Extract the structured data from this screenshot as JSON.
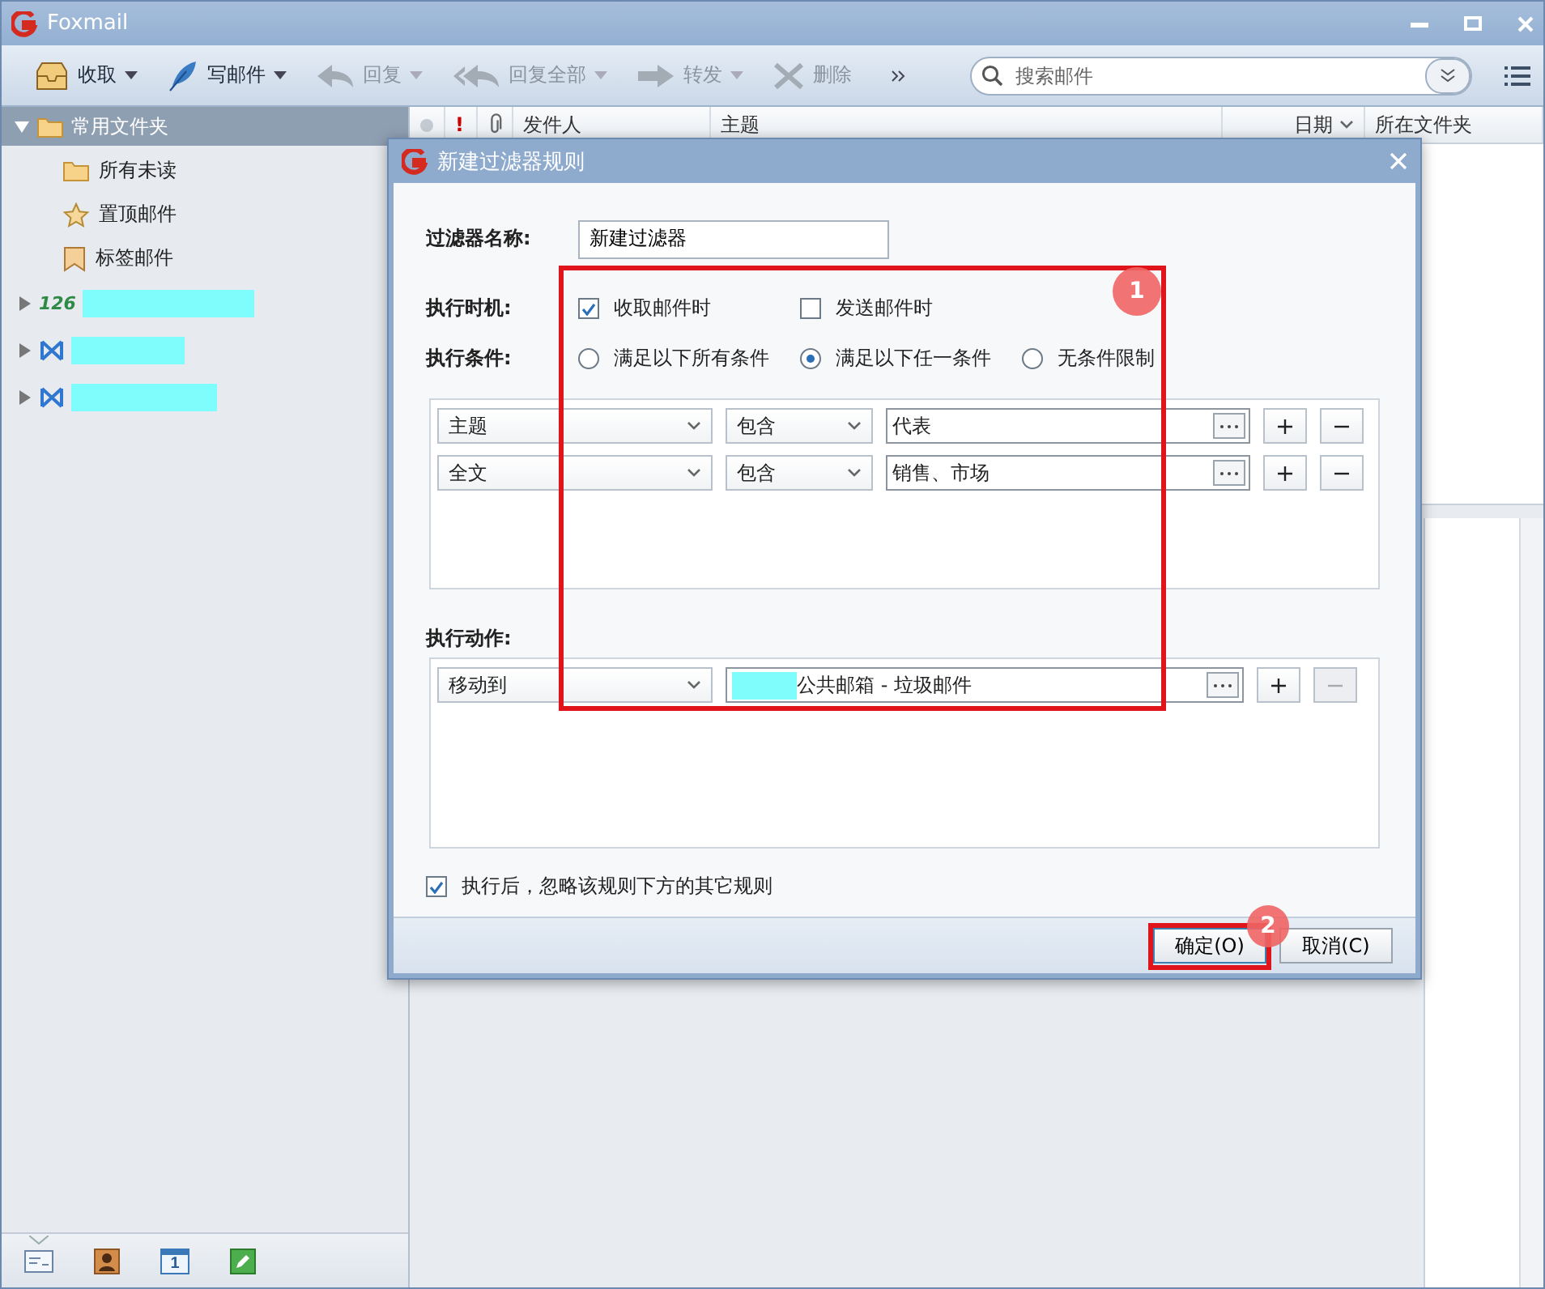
{
  "window": {
    "title": "Foxmail"
  },
  "toolbar": [
    {
      "kind": "receive",
      "label": "收取",
      "dropdown": true,
      "disabled": false
    },
    {
      "kind": "compose",
      "label": "写邮件",
      "dropdown": true,
      "disabled": false
    },
    {
      "kind": "reply",
      "label": "回复",
      "dropdown": true,
      "disabled": true
    },
    {
      "kind": "reply-all",
      "label": "回复全部",
      "dropdown": true,
      "disabled": true
    },
    {
      "kind": "forward",
      "label": "转发",
      "dropdown": true,
      "disabled": true
    },
    {
      "kind": "delete",
      "label": "删除",
      "dropdown": false,
      "disabled": true
    }
  ],
  "search": {
    "placeholder": "搜索邮件"
  },
  "sidebar": {
    "groups": [
      {
        "label": "常用文件夹",
        "expanded": true,
        "children": [
          {
            "kind": "folder",
            "label": "所有未读"
          },
          {
            "kind": "star",
            "label": "置顶邮件"
          },
          {
            "kind": "tag",
            "label": "标签邮件"
          }
        ]
      }
    ],
    "accounts": [
      {
        "kind": "netease",
        "logo_text": "126",
        "expanded": false
      },
      {
        "kind": "exchange",
        "expanded": false
      },
      {
        "kind": "exchange",
        "expanded": false
      }
    ]
  },
  "nav": [
    {
      "kind": "mail",
      "selected": true
    },
    {
      "kind": "contacts",
      "selected": false
    },
    {
      "kind": "calendar",
      "label": "1",
      "selected": false
    },
    {
      "kind": "notes",
      "selected": false
    }
  ],
  "list_columns": [
    {
      "kind": "dot"
    },
    {
      "kind": "flag",
      "label": "!"
    },
    {
      "kind": "attach"
    },
    {
      "kind": "text",
      "label": "发件人"
    },
    {
      "kind": "text",
      "label": "主题"
    },
    {
      "kind": "sort",
      "label": "日期"
    },
    {
      "kind": "text",
      "label": "所在文件夹"
    }
  ],
  "dialog": {
    "title": "新建过滤器规则",
    "name_label": "过滤器名称:",
    "name_value": "新建过滤器",
    "timing_label": "执行时机:",
    "timing": [
      {
        "label": "收取邮件时",
        "checked": true
      },
      {
        "label": "发送邮件时",
        "checked": false
      }
    ],
    "condition_label": "执行条件:",
    "condition_modes": [
      {
        "label": "满足以下所有条件",
        "selected": false
      },
      {
        "label": "满足以下任一条件",
        "selected": true
      },
      {
        "label": "无条件限制",
        "selected": false
      }
    ],
    "conditions": [
      {
        "field": "主题",
        "operator": "包含",
        "value": "代表",
        "remove_disabled": false
      },
      {
        "field": "全文",
        "operator": "包含",
        "value": "销售、市场",
        "remove_disabled": false
      }
    ],
    "action_label": "执行动作:",
    "actions": [
      {
        "action": "移动到",
        "target": "公共邮箱 - 垃圾邮件",
        "redacted": true,
        "remove_disabled": true
      }
    ],
    "ignore_rest": {
      "label": "执行后，忽略该规则下方的其它规则",
      "checked": true
    },
    "buttons": [
      {
        "label": "确定(O)",
        "default": true
      },
      {
        "label": "取消(C)",
        "default": false
      }
    ]
  },
  "annotations": [
    {
      "label": "1"
    },
    {
      "label": "2"
    }
  ]
}
